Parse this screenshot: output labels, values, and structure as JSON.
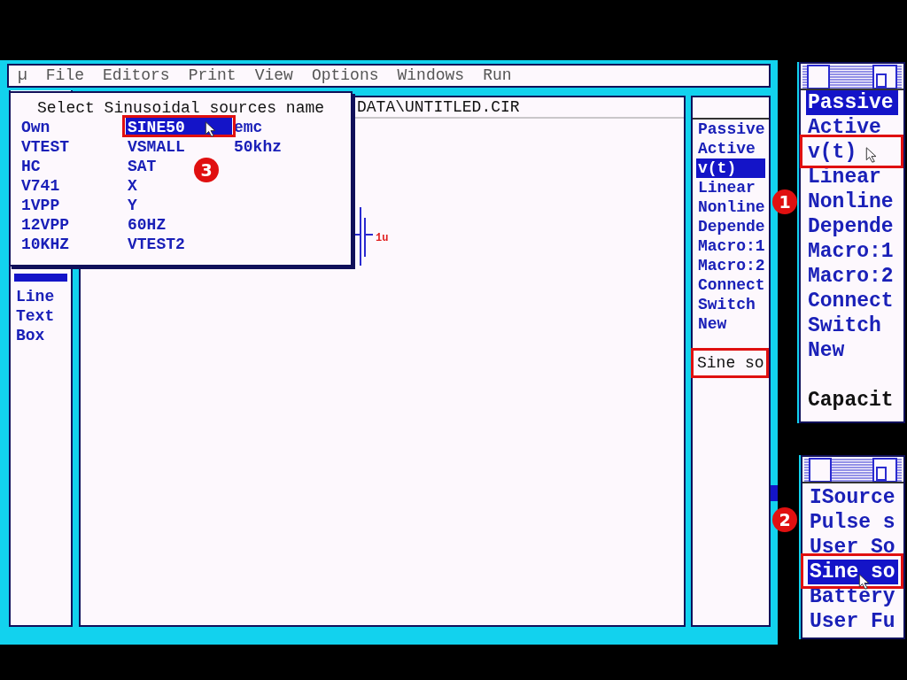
{
  "menu": [
    "µ",
    "File",
    "Editors",
    "Print",
    "View",
    "Options",
    "Windows",
    "Run"
  ],
  "dialog": {
    "title": "Select Sinusoidal sources name",
    "columns": [
      [
        {
          "label": "Own",
          "selected": false
        },
        {
          "label": "VTEST",
          "selected": false
        },
        {
          "label": "HC",
          "selected": false
        },
        {
          "label": "V741",
          "selected": false
        },
        {
          "label": "1VPP",
          "selected": false
        },
        {
          "label": "12VPP",
          "selected": false
        },
        {
          "label": "10KHZ",
          "selected": false
        }
      ],
      [
        {
          "label": "SINE50",
          "selected": true
        },
        {
          "label": "VSMALL",
          "selected": false
        },
        {
          "label": "SAT",
          "selected": false
        },
        {
          "label": "X",
          "selected": false
        },
        {
          "label": "Y",
          "selected": false
        },
        {
          "label": "60HZ",
          "selected": false
        },
        {
          "label": "VTEST2",
          "selected": false
        }
      ],
      [
        {
          "label": "emc",
          "selected": false
        },
        {
          "label": "50khz",
          "selected": false
        }
      ]
    ]
  },
  "left_palette": {
    "items": [
      {
        "label": "Line",
        "selected": false
      },
      {
        "label": "Text",
        "selected": false
      },
      {
        "label": "Box",
        "selected": false
      }
    ]
  },
  "canvas": {
    "title": "DATA\\UNTITLED.CIR",
    "capacitor_value": "1u"
  },
  "right_palette": {
    "items": [
      {
        "label": "Passive",
        "selected": false
      },
      {
        "label": "Active",
        "selected": false
      },
      {
        "label": "v(t)",
        "selected": true
      },
      {
        "label": "Linear",
        "selected": false
      },
      {
        "label": "Nonline",
        "selected": false
      },
      {
        "label": "Depende",
        "selected": false
      },
      {
        "label": "Macro:1",
        "selected": false
      },
      {
        "label": "Macro:2",
        "selected": false
      },
      {
        "label": "Connect",
        "selected": false
      },
      {
        "label": "Switch",
        "selected": false
      },
      {
        "label": "New",
        "selected": false
      }
    ],
    "status": "Sine so"
  },
  "inset_1": {
    "items": [
      {
        "label": "Passive",
        "selected": true
      },
      {
        "label": "Active",
        "selected": false
      },
      {
        "label": "v(t)",
        "selected": false
      },
      {
        "label": "Linear",
        "selected": false
      },
      {
        "label": "Nonline",
        "selected": false
      },
      {
        "label": "Depende",
        "selected": false
      },
      {
        "label": "Macro:1",
        "selected": false
      },
      {
        "label": "Macro:2",
        "selected": false
      },
      {
        "label": "Connect",
        "selected": false
      },
      {
        "label": "Switch",
        "selected": false
      },
      {
        "label": "New",
        "selected": false
      }
    ],
    "status": "Capacit"
  },
  "inset_2": {
    "items": [
      {
        "label": "ISource",
        "selected": false
      },
      {
        "label": "Pulse s",
        "selected": false
      },
      {
        "label": "User So",
        "selected": false
      },
      {
        "label": "Sine so",
        "selected": true
      },
      {
        "label": "Battery",
        "selected": false
      },
      {
        "label": "User Fu",
        "selected": false
      }
    ]
  },
  "callouts": [
    "3",
    "1",
    "2"
  ]
}
